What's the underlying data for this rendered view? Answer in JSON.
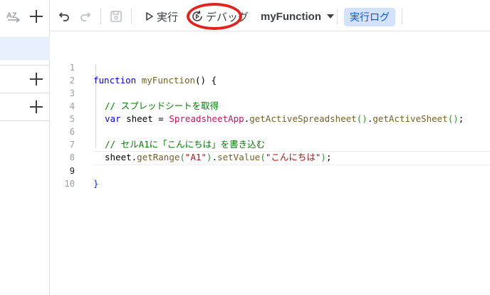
{
  "colors": {
    "accent": "#0b57d0",
    "highlight_circle": "#e3231c",
    "selected_bg": "#e8f0fe"
  },
  "icons": [
    "sort-az-icon",
    "add-icon",
    "undo-icon",
    "redo-icon",
    "save-icon",
    "play-icon",
    "debug-icon",
    "chevron-down-icon"
  ],
  "sidebar": {
    "sort_label": "AZ"
  },
  "toolbar": {
    "run_label": "実行",
    "debug_label": "デバッグ",
    "function_name": "myFunction",
    "log_label": "実行ログ"
  },
  "editor": {
    "line_numbers": [
      "1",
      "2",
      "3",
      "4",
      "5",
      "6",
      "7",
      "8",
      "9",
      "10"
    ],
    "lines": [
      {
        "kw": "function",
        "name": "myFunction",
        "paren": "()",
        "brace": "{"
      },
      {},
      {
        "comment": "// スプレッドシートを取得"
      },
      {
        "kw": "var",
        "ident": "sheet",
        "eq": "=",
        "cls": "SpreadsheetApp",
        "dot1": ".",
        "m1": "getActiveSpreadsheet",
        "p1": "()",
        "dot2": ".",
        "m2": "getActiveSheet",
        "p2": "()",
        "semi": ";"
      },
      {},
      {
        "comment": "// セルA1に「こんにちは」を書き込む"
      },
      {
        "obj": "sheet",
        "dot1": ".",
        "m1": "getRange",
        "po": "(",
        "arg": "\"A1\"",
        "pc": ")",
        "dot2": ".",
        "m2": "setValue",
        "po2": "(",
        "arg2": "\"こんにちは\"",
        "pc2": ")",
        "semi": ";"
      },
      {},
      {
        "brace": "}"
      },
      {}
    ]
  }
}
